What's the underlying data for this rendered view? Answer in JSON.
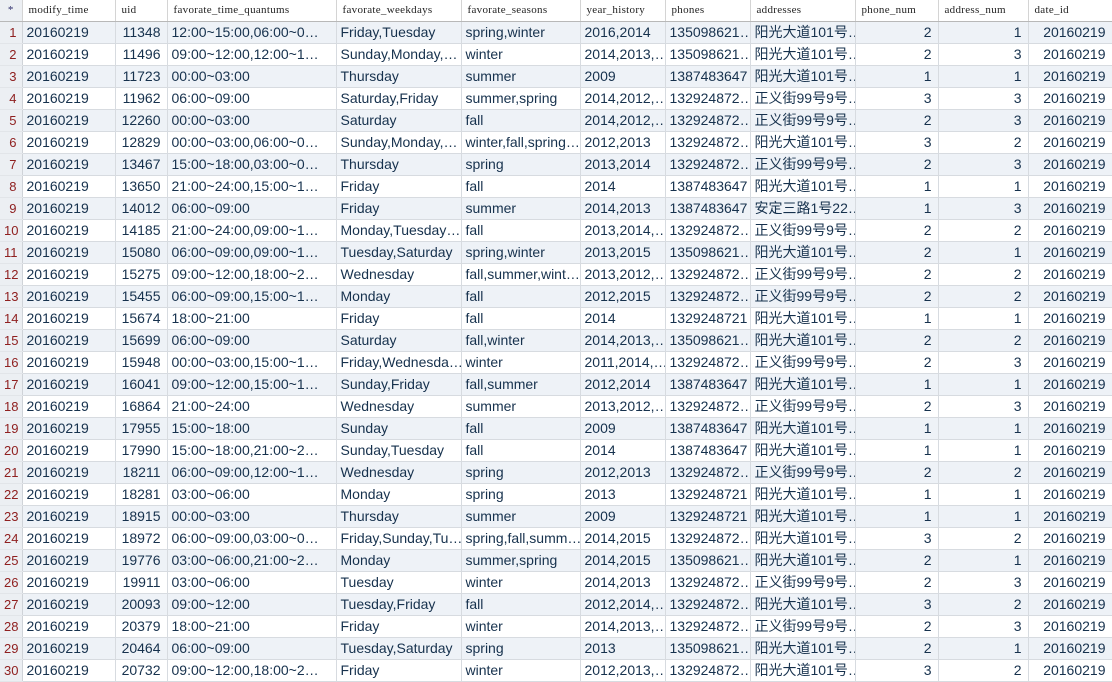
{
  "grid": {
    "row_header_glyph": "*",
    "columns": [
      {
        "key": "modify_time",
        "label": "modify_time",
        "align": "left"
      },
      {
        "key": "uid",
        "label": "uid",
        "align": "right"
      },
      {
        "key": "favorate_time_quantums",
        "label": "favorate_time_quantums",
        "align": "left"
      },
      {
        "key": "favorate_weekdays",
        "label": "favorate_weekdays",
        "align": "left"
      },
      {
        "key": "favorate_seasons",
        "label": "favorate_seasons",
        "align": "left"
      },
      {
        "key": "year_history",
        "label": "year_history",
        "align": "left"
      },
      {
        "key": "phones",
        "label": "phones",
        "align": "left"
      },
      {
        "key": "addresses",
        "label": "addresses",
        "align": "left"
      },
      {
        "key": "phone_num",
        "label": "phone_num",
        "align": "right"
      },
      {
        "key": "address_num",
        "label": "address_num",
        "align": "right"
      },
      {
        "key": "date_id",
        "label": "date_id",
        "align": "right"
      }
    ],
    "colors": {
      "header_text": "#1f1f1f",
      "row_number_text": "#8f2020",
      "cell_text": "#16314d",
      "odd_row_bg": "#eef2f7",
      "even_row_bg": "#ffffff",
      "row_header_bg": "#eceff3",
      "grid_line": "#d7dbe0"
    },
    "rows": [
      {
        "n": "1",
        "modify_time": "20160219",
        "uid": "11348",
        "favorate_time_quantums": "12:00~15:00,06:00~0…",
        "favorate_weekdays": "Friday,Tuesday",
        "favorate_seasons": "spring,winter",
        "year_history": "2016,2014",
        "phones": "135098621…",
        "addresses": "阳光大道101号…",
        "phone_num": "2",
        "address_num": "1",
        "date_id": "20160219"
      },
      {
        "n": "2",
        "modify_time": "20160219",
        "uid": "11496",
        "favorate_time_quantums": "09:00~12:00,12:00~1…",
        "favorate_weekdays": "Sunday,Monday,…",
        "favorate_seasons": "winter",
        "year_history": "2014,2013,…",
        "phones": "135098621…",
        "addresses": "阳光大道101号…",
        "phone_num": "2",
        "address_num": "3",
        "date_id": "20160219"
      },
      {
        "n": "3",
        "modify_time": "20160219",
        "uid": "11723",
        "favorate_time_quantums": "00:00~03:00",
        "favorate_weekdays": "Thursday",
        "favorate_seasons": "summer",
        "year_history": "2009",
        "phones": "1387483647",
        "addresses": "阳光大道101号…",
        "phone_num": "1",
        "address_num": "1",
        "date_id": "20160219"
      },
      {
        "n": "4",
        "modify_time": "20160219",
        "uid": "11962",
        "favorate_time_quantums": "06:00~09:00",
        "favorate_weekdays": "Saturday,Friday",
        "favorate_seasons": "summer,spring",
        "year_history": "2014,2012,…",
        "phones": "132924872…",
        "addresses": "正义街99号9号…",
        "phone_num": "3",
        "address_num": "3",
        "date_id": "20160219"
      },
      {
        "n": "5",
        "modify_time": "20160219",
        "uid": "12260",
        "favorate_time_quantums": "00:00~03:00",
        "favorate_weekdays": "Saturday",
        "favorate_seasons": "fall",
        "year_history": "2014,2012,…",
        "phones": "132924872…",
        "addresses": "正义街99号9号…",
        "phone_num": "2",
        "address_num": "3",
        "date_id": "20160219"
      },
      {
        "n": "6",
        "modify_time": "20160219",
        "uid": "12829",
        "favorate_time_quantums": "00:00~03:00,06:00~0…",
        "favorate_weekdays": "Sunday,Monday,…",
        "favorate_seasons": "winter,fall,spring…",
        "year_history": "2012,2013",
        "phones": "132924872…",
        "addresses": "阳光大道101号…",
        "phone_num": "3",
        "address_num": "2",
        "date_id": "20160219"
      },
      {
        "n": "7",
        "modify_time": "20160219",
        "uid": "13467",
        "favorate_time_quantums": "15:00~18:00,03:00~0…",
        "favorate_weekdays": "Thursday",
        "favorate_seasons": "spring",
        "year_history": "2013,2014",
        "phones": "132924872…",
        "addresses": "正义街99号9号…",
        "phone_num": "2",
        "address_num": "3",
        "date_id": "20160219"
      },
      {
        "n": "8",
        "modify_time": "20160219",
        "uid": "13650",
        "favorate_time_quantums": "21:00~24:00,15:00~1…",
        "favorate_weekdays": "Friday",
        "favorate_seasons": "fall",
        "year_history": "2014",
        "phones": "1387483647",
        "addresses": "阳光大道101号…",
        "phone_num": "1",
        "address_num": "1",
        "date_id": "20160219"
      },
      {
        "n": "9",
        "modify_time": "20160219",
        "uid": "14012",
        "favorate_time_quantums": "06:00~09:00",
        "favorate_weekdays": "Friday",
        "favorate_seasons": "summer",
        "year_history": "2014,2013",
        "phones": "1387483647",
        "addresses": "安定三路1号22…",
        "phone_num": "1",
        "address_num": "3",
        "date_id": "20160219"
      },
      {
        "n": "10",
        "modify_time": "20160219",
        "uid": "14185",
        "favorate_time_quantums": "21:00~24:00,09:00~1…",
        "favorate_weekdays": "Monday,Tuesday…",
        "favorate_seasons": "fall",
        "year_history": "2013,2014,…",
        "phones": "132924872…",
        "addresses": "正义街99号9号…",
        "phone_num": "2",
        "address_num": "2",
        "date_id": "20160219"
      },
      {
        "n": "11",
        "modify_time": "20160219",
        "uid": "15080",
        "favorate_time_quantums": "06:00~09:00,09:00~1…",
        "favorate_weekdays": "Tuesday,Saturday",
        "favorate_seasons": "spring,winter",
        "year_history": "2013,2015",
        "phones": "135098621…",
        "addresses": "阳光大道101号…",
        "phone_num": "2",
        "address_num": "1",
        "date_id": "20160219"
      },
      {
        "n": "12",
        "modify_time": "20160219",
        "uid": "15275",
        "favorate_time_quantums": "09:00~12:00,18:00~2…",
        "favorate_weekdays": "Wednesday",
        "favorate_seasons": "fall,summer,wint…",
        "year_history": "2013,2012,…",
        "phones": "132924872…",
        "addresses": "正义街99号9号…",
        "phone_num": "2",
        "address_num": "2",
        "date_id": "20160219"
      },
      {
        "n": "13",
        "modify_time": "20160219",
        "uid": "15455",
        "favorate_time_quantums": "06:00~09:00,15:00~1…",
        "favorate_weekdays": "Monday",
        "favorate_seasons": "fall",
        "year_history": "2012,2015",
        "phones": "132924872…",
        "addresses": "正义街99号9号…",
        "phone_num": "2",
        "address_num": "2",
        "date_id": "20160219"
      },
      {
        "n": "14",
        "modify_time": "20160219",
        "uid": "15674",
        "favorate_time_quantums": "18:00~21:00",
        "favorate_weekdays": "Friday",
        "favorate_seasons": "fall",
        "year_history": "2014",
        "phones": "1329248721",
        "addresses": "阳光大道101号…",
        "phone_num": "1",
        "address_num": "1",
        "date_id": "20160219"
      },
      {
        "n": "15",
        "modify_time": "20160219",
        "uid": "15699",
        "favorate_time_quantums": "06:00~09:00",
        "favorate_weekdays": "Saturday",
        "favorate_seasons": "fall,winter",
        "year_history": "2014,2013,…",
        "phones": "135098621…",
        "addresses": "阳光大道101号…",
        "phone_num": "2",
        "address_num": "2",
        "date_id": "20160219"
      },
      {
        "n": "16",
        "modify_time": "20160219",
        "uid": "15948",
        "favorate_time_quantums": "00:00~03:00,15:00~1…",
        "favorate_weekdays": "Friday,Wednesda…",
        "favorate_seasons": "winter",
        "year_history": "2011,2014,…",
        "phones": "132924872…",
        "addresses": "正义街99号9号…",
        "phone_num": "2",
        "address_num": "3",
        "date_id": "20160219"
      },
      {
        "n": "17",
        "modify_time": "20160219",
        "uid": "16041",
        "favorate_time_quantums": "09:00~12:00,15:00~1…",
        "favorate_weekdays": "Sunday,Friday",
        "favorate_seasons": "fall,summer",
        "year_history": "2012,2014",
        "phones": "1387483647",
        "addresses": "阳光大道101号…",
        "phone_num": "1",
        "address_num": "1",
        "date_id": "20160219"
      },
      {
        "n": "18",
        "modify_time": "20160219",
        "uid": "16864",
        "favorate_time_quantums": "21:00~24:00",
        "favorate_weekdays": "Wednesday",
        "favorate_seasons": "summer",
        "year_history": "2013,2012,…",
        "phones": "132924872…",
        "addresses": "正义街99号9号…",
        "phone_num": "2",
        "address_num": "3",
        "date_id": "20160219"
      },
      {
        "n": "19",
        "modify_time": "20160219",
        "uid": "17955",
        "favorate_time_quantums": "15:00~18:00",
        "favorate_weekdays": "Sunday",
        "favorate_seasons": "fall",
        "year_history": "2009",
        "phones": "1387483647",
        "addresses": "阳光大道101号…",
        "phone_num": "1",
        "address_num": "1",
        "date_id": "20160219"
      },
      {
        "n": "20",
        "modify_time": "20160219",
        "uid": "17990",
        "favorate_time_quantums": "15:00~18:00,21:00~2…",
        "favorate_weekdays": "Sunday,Tuesday",
        "favorate_seasons": "fall",
        "year_history": "2014",
        "phones": "1387483647",
        "addresses": "阳光大道101号…",
        "phone_num": "1",
        "address_num": "1",
        "date_id": "20160219"
      },
      {
        "n": "21",
        "modify_time": "20160219",
        "uid": "18211",
        "favorate_time_quantums": "06:00~09:00,12:00~1…",
        "favorate_weekdays": "Wednesday",
        "favorate_seasons": "spring",
        "year_history": "2012,2013",
        "phones": "132924872…",
        "addresses": "正义街99号9号…",
        "phone_num": "2",
        "address_num": "2",
        "date_id": "20160219"
      },
      {
        "n": "22",
        "modify_time": "20160219",
        "uid": "18281",
        "favorate_time_quantums": "03:00~06:00",
        "favorate_weekdays": "Monday",
        "favorate_seasons": "spring",
        "year_history": "2013",
        "phones": "1329248721",
        "addresses": "阳光大道101号…",
        "phone_num": "1",
        "address_num": "1",
        "date_id": "20160219"
      },
      {
        "n": "23",
        "modify_time": "20160219",
        "uid": "18915",
        "favorate_time_quantums": "00:00~03:00",
        "favorate_weekdays": "Thursday",
        "favorate_seasons": "summer",
        "year_history": "2009",
        "phones": "1329248721",
        "addresses": "阳光大道101号…",
        "phone_num": "1",
        "address_num": "1",
        "date_id": "20160219"
      },
      {
        "n": "24",
        "modify_time": "20160219",
        "uid": "18972",
        "favorate_time_quantums": "06:00~09:00,03:00~0…",
        "favorate_weekdays": "Friday,Sunday,Tu…",
        "favorate_seasons": "spring,fall,summ…",
        "year_history": "2014,2015",
        "phones": "132924872…",
        "addresses": "阳光大道101号…",
        "phone_num": "3",
        "address_num": "2",
        "date_id": "20160219"
      },
      {
        "n": "25",
        "modify_time": "20160219",
        "uid": "19776",
        "favorate_time_quantums": "03:00~06:00,21:00~2…",
        "favorate_weekdays": "Monday",
        "favorate_seasons": "summer,spring",
        "year_history": "2014,2015",
        "phones": "135098621…",
        "addresses": "阳光大道101号…",
        "phone_num": "2",
        "address_num": "1",
        "date_id": "20160219"
      },
      {
        "n": "26",
        "modify_time": "20160219",
        "uid": "19911",
        "favorate_time_quantums": "03:00~06:00",
        "favorate_weekdays": "Tuesday",
        "favorate_seasons": "winter",
        "year_history": "2014,2013",
        "phones": "132924872…",
        "addresses": "正义街99号9号…",
        "phone_num": "2",
        "address_num": "3",
        "date_id": "20160219"
      },
      {
        "n": "27",
        "modify_time": "20160219",
        "uid": "20093",
        "favorate_time_quantums": "09:00~12:00",
        "favorate_weekdays": "Tuesday,Friday",
        "favorate_seasons": "fall",
        "year_history": "2012,2014,…",
        "phones": "132924872…",
        "addresses": "阳光大道101号…",
        "phone_num": "3",
        "address_num": "2",
        "date_id": "20160219"
      },
      {
        "n": "28",
        "modify_time": "20160219",
        "uid": "20379",
        "favorate_time_quantums": "18:00~21:00",
        "favorate_weekdays": "Friday",
        "favorate_seasons": "winter",
        "year_history": "2014,2013,…",
        "phones": "132924872…",
        "addresses": "正义街99号9号…",
        "phone_num": "2",
        "address_num": "3",
        "date_id": "20160219"
      },
      {
        "n": "29",
        "modify_time": "20160219",
        "uid": "20464",
        "favorate_time_quantums": "06:00~09:00",
        "favorate_weekdays": "Tuesday,Saturday",
        "favorate_seasons": "spring",
        "year_history": "2013",
        "phones": "135098621…",
        "addresses": "阳光大道101号…",
        "phone_num": "2",
        "address_num": "1",
        "date_id": "20160219"
      },
      {
        "n": "30",
        "modify_time": "20160219",
        "uid": "20732",
        "favorate_time_quantums": "09:00~12:00,18:00~2…",
        "favorate_weekdays": "Friday",
        "favorate_seasons": "winter",
        "year_history": "2012,2013,…",
        "phones": "132924872…",
        "addresses": "阳光大道101号…",
        "phone_num": "3",
        "address_num": "2",
        "date_id": "20160219"
      }
    ]
  }
}
